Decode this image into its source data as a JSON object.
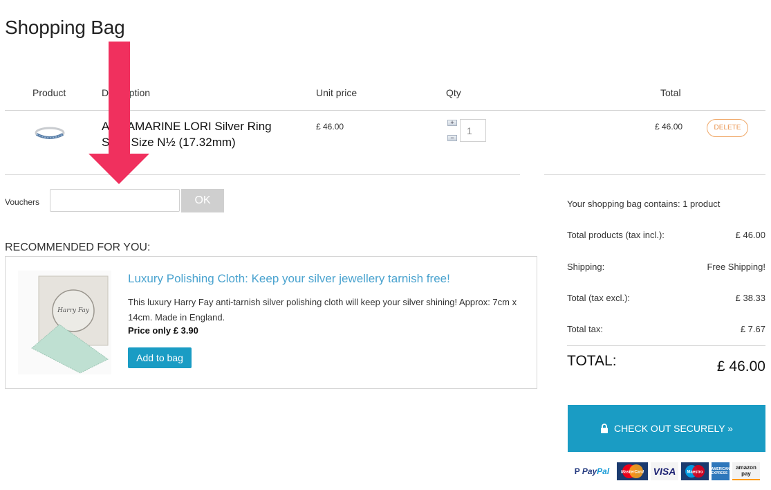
{
  "page": {
    "title": "Shopping Bag"
  },
  "cart": {
    "headers": {
      "product": "Product",
      "description": "Description",
      "unit_price": "Unit price",
      "qty": "Qty",
      "total": "Total"
    },
    "items": [
      {
        "name": "AQUAMARINE LORI Silver Ring",
        "size": "Size: Size N½ (17.32mm)",
        "unit_price": "£ 46.00",
        "qty": "1",
        "total": "£ 46.00",
        "qty_plus": "+",
        "qty_minus": "−",
        "delete_label": "DELETE"
      }
    ]
  },
  "vouchers": {
    "label": "Vouchers",
    "value": "",
    "placeholder": "",
    "ok_label": "OK"
  },
  "recommended": {
    "title": "RECOMMENDED FOR YOU:",
    "items": [
      {
        "heading": "Luxury Polishing Cloth: Keep your silver jewellery tarnish free!",
        "description": "This luxury Harry Fay anti-tarnish silver polishing cloth will keep your silver shining! Approx: 7cm x 14cm. Made in England.",
        "price": "Price only £ 3.90",
        "add_label": "Add to bag",
        "brand_text": "Harry Fay"
      }
    ]
  },
  "summary": {
    "contains": "Your shopping bag contains: 1 product",
    "rows": [
      {
        "label": "Total products (tax incl.):",
        "value": "£ 46.00"
      },
      {
        "label": "Shipping:",
        "value": "Free Shipping!"
      },
      {
        "label": "Total (tax excl.):",
        "value": "£ 38.33"
      },
      {
        "label": "Total tax:",
        "value": "£ 7.67"
      }
    ],
    "total_label": "TOTAL:",
    "total_value": "£ 46.00",
    "checkout_label": "CHECK OUT SECURELY »"
  },
  "payment_methods": {
    "paypal_a": "Pay",
    "paypal_b": "Pal",
    "mastercard": "MasterCard",
    "visa": "VISA",
    "maestro": "Maestro",
    "amex": "AMERICAN EXPRESS",
    "amazon_a": "amazon",
    "amazon_b": "pay"
  },
  "colors": {
    "accent": "#1a9cc4",
    "link": "#4aa3cf",
    "delete": "#e8914a",
    "annotation_arrow": "#f0305e"
  }
}
